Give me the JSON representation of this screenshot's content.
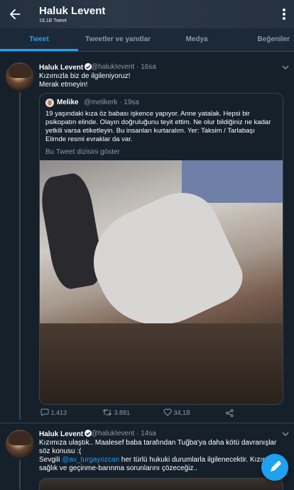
{
  "header": {
    "title": "Haluk Levent",
    "subtitle": "19,1B Tweet"
  },
  "tabs": [
    "Tweet",
    "Tweetler ve yanıtlar",
    "Medya",
    "Beğeniler"
  ],
  "tweet1": {
    "name": "Haluk Levent",
    "handle": "@halukIevent",
    "time": "· 16sa",
    "text_line1": "Kızımızla biz de ilgileniyoruz!",
    "text_line2": "Merak etmeyin!",
    "quote": {
      "name": "Melike",
      "handle": "@melikerk",
      "time": "· 19sa",
      "text": "19 yaşındaki kıza öz babası işkence yapıyor. Anne yatalak. Hepsi bir psikopatın elinde. Olayın doğruluğunu teyit ettim. Ne olur bildiğiniz ne kadar yetkili varsa etiketleyin. Bu insanları kurtaralım. Yer: Taksim / Tarlabaşı Elimde resmi evraklar da var.",
      "thread_link": "Bu Tweet dizisini göster"
    },
    "replies": "1.413",
    "retweets": "3.881",
    "likes": "34,1B"
  },
  "tweet2": {
    "name": "Haluk Levent",
    "handle": "@halukIevent",
    "time": "· 14sa",
    "line1": "Kızımıza ulaştık.. Maalesef baba tarafından Tuğba'ya  daha kötü davranışlar",
    "line2": "söz konusu :(",
    "line3_prefix": "Sevgili ",
    "line3_mention": "@av_turgayozcan",
    "line3_suffix": " her türlü hukuki durumlarla ilgilenecektir. Kızımızın",
    "line4": "sağlık ve geçinme-barınma sorunlarını çözeceğiz.."
  },
  "colors": {
    "background": "#15202b",
    "accent": "#1da1f2",
    "muted": "#8899a6",
    "border": "#38444d"
  },
  "icons": [
    "back-arrow-icon",
    "more-vertical-icon",
    "verified-badge-icon",
    "chevron-down-icon",
    "reply-icon",
    "retweet-icon",
    "like-icon",
    "share-icon",
    "compose-tweet-icon"
  ]
}
